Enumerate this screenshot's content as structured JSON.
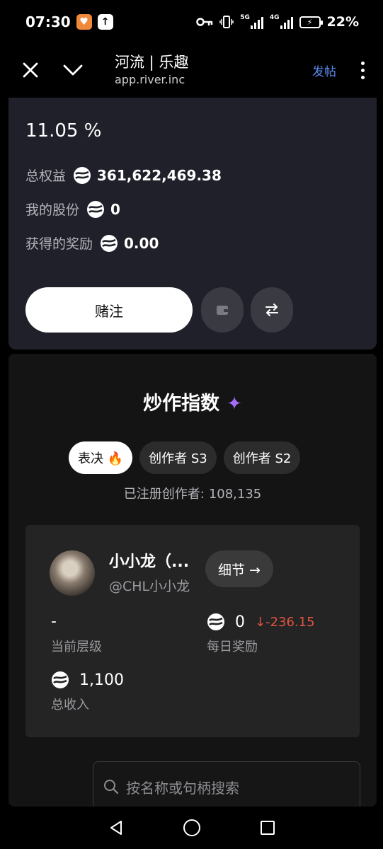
{
  "status_bar": {
    "time": "07:30",
    "battery": "22%",
    "net1": "5G",
    "net2": "4G"
  },
  "header": {
    "title": "河流 | 乐趣",
    "url": "app.river.inc",
    "post_label": "发帖"
  },
  "stake": {
    "percentage": "11.05 %",
    "total_equity_label": "总权益",
    "total_equity_value": "361,622,469.38",
    "my_shares_label": "我的股份",
    "my_shares_value": "0",
    "rewards_label": "获得的奖励",
    "rewards_value": "0.00",
    "bet_label": "赌注"
  },
  "hype": {
    "title": "炒作指数",
    "tabs": [
      {
        "label": "表决 🔥"
      },
      {
        "label": "创作者 S3"
      },
      {
        "label": "创作者 S2"
      }
    ],
    "registered_label": "已注册创作者:",
    "registered_value": "108,135"
  },
  "creator": {
    "name": "小小龙（...",
    "handle": "@CHL小小龙",
    "detail_label": "细节 →",
    "tier_value": "-",
    "tier_label": "当前层级",
    "daily_value": "0",
    "daily_delta": "↓-236.15",
    "daily_label": "每日奖励",
    "total_value": "1,100",
    "total_label": "总收入"
  },
  "search": {
    "placeholder": "按名称或句柄搜索"
  },
  "colors": {
    "accent_blue": "#5b8def",
    "negative_red": "#e0533f",
    "sparkle_purple": "#a36cf5",
    "card_bg": "#20202a"
  }
}
